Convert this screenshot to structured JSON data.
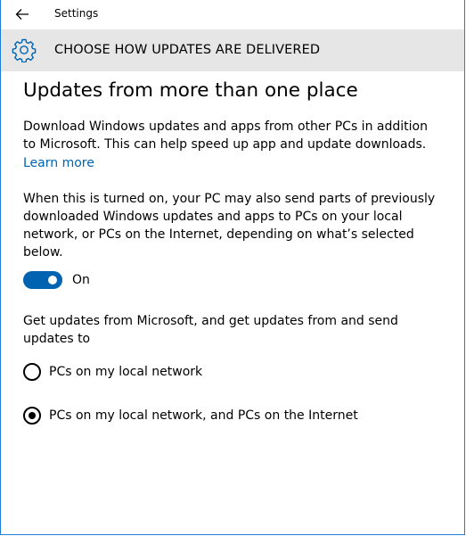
{
  "window": {
    "title": "Settings",
    "accent_color": "#1c7fd4"
  },
  "header": {
    "icon": "gear-icon",
    "title": "CHOOSE HOW UPDATES ARE DELIVERED"
  },
  "main": {
    "page_title": "Updates from more than one place",
    "description": "Download Windows updates and apps from other PCs in addition to Microsoft. This can help speed up app and update downloads.",
    "learn_more": "Learn more",
    "toggle_description": "When this is turned on, your PC may also send parts of previously downloaded Windows updates and apps to PCs on your local network, or PCs on the Internet, depending on what’s selected below.",
    "toggle": {
      "state": true,
      "label": "On",
      "color": "#0063b1"
    },
    "options_description": "Get updates from Microsoft, and get updates from and send updates to",
    "options": [
      {
        "label": "PCs on my local network",
        "selected": false
      },
      {
        "label": "PCs on my local network, and PCs on the Internet",
        "selected": true
      }
    ]
  }
}
